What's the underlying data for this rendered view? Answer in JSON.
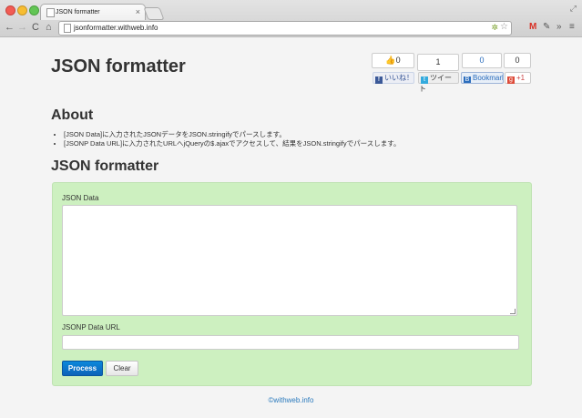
{
  "browser": {
    "tab_title": "JSON formatter",
    "tab_close": "×",
    "url": "jsonformatter.withweb.info",
    "nav_back": "←",
    "nav_forward": "→",
    "nav_reload": "C",
    "nav_home": "⌂",
    "toolbar_more": "»",
    "toolbar_menu": "≡",
    "resize_glyph": "⤢"
  },
  "header": {
    "title": "JSON formatter",
    "social": {
      "facebook_count": "0",
      "facebook_label": "いいね！",
      "twitter_count": "1",
      "twitter_label": "ツイート",
      "hatena_count": "0",
      "hatena_label": "Bookmark",
      "gplus_count": "0",
      "gplus_label": "+1"
    }
  },
  "about": {
    "title": "About",
    "items": [
      "[JSON Data]に入力されたJSONデータをJSON.stringifyでパースします。",
      "[JSONP Data URL]に入力されたURLへjQueryの$.ajaxでアクセスして、結果をJSON.stringifyでパースします。"
    ]
  },
  "formatter": {
    "title": "JSON formatter",
    "json_label": "JSON Data",
    "json_value": "",
    "jsonp_label": "JSONP Data URL",
    "jsonp_value": "",
    "process_label": "Process",
    "clear_label": "Clear"
  },
  "footer": {
    "text": "©withweb.info"
  },
  "colors": {
    "panel_bg": "#cdf0c0",
    "process_button": "#0c6fcb",
    "link": "#2b7abd"
  }
}
